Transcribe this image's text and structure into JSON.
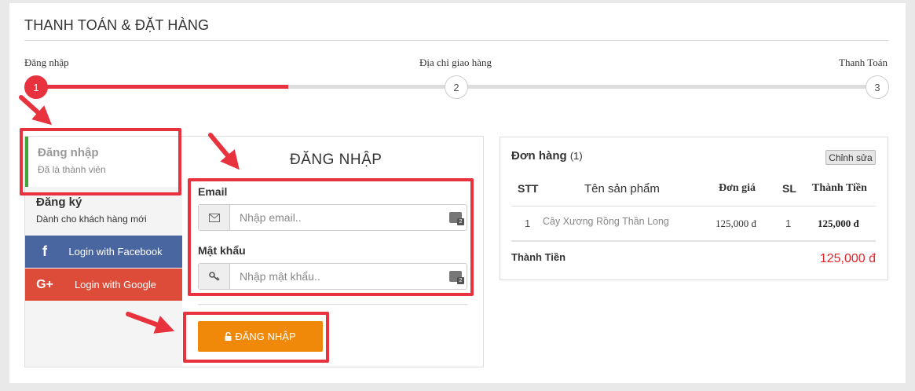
{
  "title": "THANH TOÁN & ĐẶT HÀNG",
  "steps": [
    {
      "label": "Đăng nhập",
      "number": "1"
    },
    {
      "label": "Địa chỉ giao hàng",
      "number": "2"
    },
    {
      "label": "Thanh Toán",
      "number": "3"
    }
  ],
  "progress_fraction": 0.3,
  "sidebar": {
    "login_title": "Đăng nhập",
    "login_sub": "Đã là thành viên",
    "register_title": "Đăng ký",
    "register_sub": "Dành cho khách hàng mới",
    "facebook_icon": "f",
    "facebook": "Login with Facebook",
    "google_icon": "G+",
    "google": "Login with Google"
  },
  "form": {
    "title": "ĐĂNG NHẬP",
    "email_label": "Email",
    "email_placeholder": "Nhập email..",
    "password_label": "Mật khẩu",
    "password_placeholder": "Nhập mật khẩu..",
    "password_manager_badge": "2",
    "submit": "ĐĂNG NHẬP"
  },
  "order": {
    "title": "Đơn hàng",
    "count": "(1)",
    "edit": "Chỉnh sửa",
    "columns": {
      "stt": "STT",
      "name": "Tên sản phẩm",
      "price": "Đơn giá",
      "qty": "SL",
      "total": "Thành Tiền"
    },
    "rows": [
      {
        "stt": "1",
        "name": "Cây Xương Rồng Thần Long",
        "price": "125,000 đ",
        "qty": "1",
        "total": "125,000 đ"
      }
    ],
    "total_label": "Thành Tiền",
    "total_value": "125,000 đ"
  },
  "colors": {
    "accent": "#e8323d",
    "login_button": "#f0880a",
    "facebook": "#4a66a0",
    "google": "#dd4b39",
    "total": "#e8232a"
  }
}
